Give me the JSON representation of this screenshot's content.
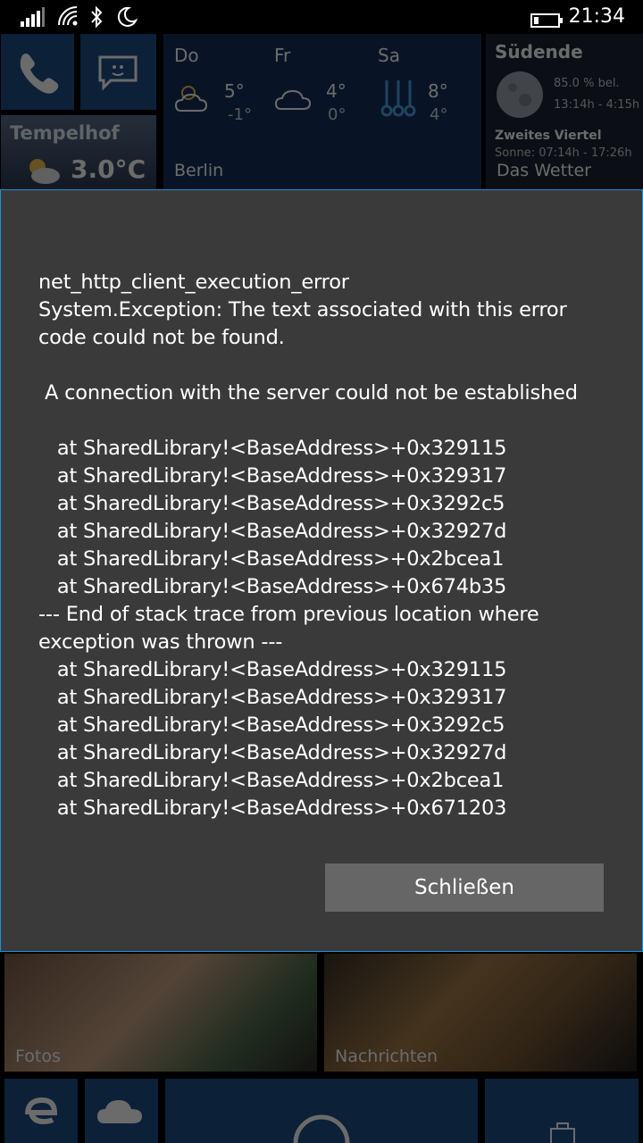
{
  "status_bar": {
    "time": "21:34"
  },
  "tiles": {
    "weather_city": "Tempelhof",
    "weather_city_temp": "3.0°C",
    "forecast": {
      "location": "Berlin",
      "days": [
        {
          "day": "Do",
          "hi": "5°",
          "lo": "-1°",
          "icon": "sun-cloud-icon"
        },
        {
          "day": "Fr",
          "hi": "4°",
          "lo": "0°",
          "icon": "cloud-icon"
        },
        {
          "day": "Sa",
          "hi": "8°",
          "lo": "4°",
          "icon": "thermometer-icon"
        }
      ]
    },
    "moon": {
      "title": "Südende",
      "illum": "85.0 % bel.",
      "time": "13:14h - 4:15h",
      "phase": "Zweites Viertel",
      "sun": "Sonne: 07:14h - 17:26h",
      "app": "Das Wetter"
    },
    "photos_label": "Fotos",
    "news_label": "Nachrichten"
  },
  "dialog": {
    "message": "net_http_client_execution_error\nSystem.Exception: The text associated with this error\ncode could not be found.\n\n A connection with the server could not be established\n\n   at SharedLibrary!<BaseAddress>+0x329115\n   at SharedLibrary!<BaseAddress>+0x329317\n   at SharedLibrary!<BaseAddress>+0x3292c5\n   at SharedLibrary!<BaseAddress>+0x32927d\n   at SharedLibrary!<BaseAddress>+0x2bcea1\n   at SharedLibrary!<BaseAddress>+0x674b35\n--- End of stack trace from previous location where\nexception was thrown ---\n   at SharedLibrary!<BaseAddress>+0x329115\n   at SharedLibrary!<BaseAddress>+0x329317\n   at SharedLibrary!<BaseAddress>+0x3292c5\n   at SharedLibrary!<BaseAddress>+0x32927d\n   at SharedLibrary!<BaseAddress>+0x2bcea1\n   at SharedLibrary!<BaseAddress>+0x671203",
    "close_label": "Schließen"
  }
}
